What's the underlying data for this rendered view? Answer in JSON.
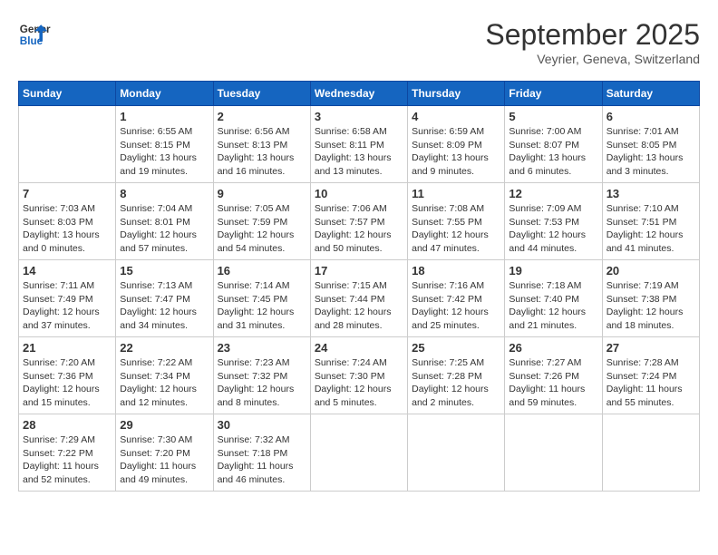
{
  "logo": {
    "line1": "General",
    "line2": "Blue"
  },
  "title": "September 2025",
  "location": "Veyrier, Geneva, Switzerland",
  "weekdays": [
    "Sunday",
    "Monday",
    "Tuesday",
    "Wednesday",
    "Thursday",
    "Friday",
    "Saturday"
  ],
  "weeks": [
    [
      {
        "day": "",
        "info": ""
      },
      {
        "day": "1",
        "info": "Sunrise: 6:55 AM\nSunset: 8:15 PM\nDaylight: 13 hours\nand 19 minutes."
      },
      {
        "day": "2",
        "info": "Sunrise: 6:56 AM\nSunset: 8:13 PM\nDaylight: 13 hours\nand 16 minutes."
      },
      {
        "day": "3",
        "info": "Sunrise: 6:58 AM\nSunset: 8:11 PM\nDaylight: 13 hours\nand 13 minutes."
      },
      {
        "day": "4",
        "info": "Sunrise: 6:59 AM\nSunset: 8:09 PM\nDaylight: 13 hours\nand 9 minutes."
      },
      {
        "day": "5",
        "info": "Sunrise: 7:00 AM\nSunset: 8:07 PM\nDaylight: 13 hours\nand 6 minutes."
      },
      {
        "day": "6",
        "info": "Sunrise: 7:01 AM\nSunset: 8:05 PM\nDaylight: 13 hours\nand 3 minutes."
      }
    ],
    [
      {
        "day": "7",
        "info": "Sunrise: 7:03 AM\nSunset: 8:03 PM\nDaylight: 13 hours\nand 0 minutes."
      },
      {
        "day": "8",
        "info": "Sunrise: 7:04 AM\nSunset: 8:01 PM\nDaylight: 12 hours\nand 57 minutes."
      },
      {
        "day": "9",
        "info": "Sunrise: 7:05 AM\nSunset: 7:59 PM\nDaylight: 12 hours\nand 54 minutes."
      },
      {
        "day": "10",
        "info": "Sunrise: 7:06 AM\nSunset: 7:57 PM\nDaylight: 12 hours\nand 50 minutes."
      },
      {
        "day": "11",
        "info": "Sunrise: 7:08 AM\nSunset: 7:55 PM\nDaylight: 12 hours\nand 47 minutes."
      },
      {
        "day": "12",
        "info": "Sunrise: 7:09 AM\nSunset: 7:53 PM\nDaylight: 12 hours\nand 44 minutes."
      },
      {
        "day": "13",
        "info": "Sunrise: 7:10 AM\nSunset: 7:51 PM\nDaylight: 12 hours\nand 41 minutes."
      }
    ],
    [
      {
        "day": "14",
        "info": "Sunrise: 7:11 AM\nSunset: 7:49 PM\nDaylight: 12 hours\nand 37 minutes."
      },
      {
        "day": "15",
        "info": "Sunrise: 7:13 AM\nSunset: 7:47 PM\nDaylight: 12 hours\nand 34 minutes."
      },
      {
        "day": "16",
        "info": "Sunrise: 7:14 AM\nSunset: 7:45 PM\nDaylight: 12 hours\nand 31 minutes."
      },
      {
        "day": "17",
        "info": "Sunrise: 7:15 AM\nSunset: 7:44 PM\nDaylight: 12 hours\nand 28 minutes."
      },
      {
        "day": "18",
        "info": "Sunrise: 7:16 AM\nSunset: 7:42 PM\nDaylight: 12 hours\nand 25 minutes."
      },
      {
        "day": "19",
        "info": "Sunrise: 7:18 AM\nSunset: 7:40 PM\nDaylight: 12 hours\nand 21 minutes."
      },
      {
        "day": "20",
        "info": "Sunrise: 7:19 AM\nSunset: 7:38 PM\nDaylight: 12 hours\nand 18 minutes."
      }
    ],
    [
      {
        "day": "21",
        "info": "Sunrise: 7:20 AM\nSunset: 7:36 PM\nDaylight: 12 hours\nand 15 minutes."
      },
      {
        "day": "22",
        "info": "Sunrise: 7:22 AM\nSunset: 7:34 PM\nDaylight: 12 hours\nand 12 minutes."
      },
      {
        "day": "23",
        "info": "Sunrise: 7:23 AM\nSunset: 7:32 PM\nDaylight: 12 hours\nand 8 minutes."
      },
      {
        "day": "24",
        "info": "Sunrise: 7:24 AM\nSunset: 7:30 PM\nDaylight: 12 hours\nand 5 minutes."
      },
      {
        "day": "25",
        "info": "Sunrise: 7:25 AM\nSunset: 7:28 PM\nDaylight: 12 hours\nand 2 minutes."
      },
      {
        "day": "26",
        "info": "Sunrise: 7:27 AM\nSunset: 7:26 PM\nDaylight: 11 hours\nand 59 minutes."
      },
      {
        "day": "27",
        "info": "Sunrise: 7:28 AM\nSunset: 7:24 PM\nDaylight: 11 hours\nand 55 minutes."
      }
    ],
    [
      {
        "day": "28",
        "info": "Sunrise: 7:29 AM\nSunset: 7:22 PM\nDaylight: 11 hours\nand 52 minutes."
      },
      {
        "day": "29",
        "info": "Sunrise: 7:30 AM\nSunset: 7:20 PM\nDaylight: 11 hours\nand 49 minutes."
      },
      {
        "day": "30",
        "info": "Sunrise: 7:32 AM\nSunset: 7:18 PM\nDaylight: 11 hours\nand 46 minutes."
      },
      {
        "day": "",
        "info": ""
      },
      {
        "day": "",
        "info": ""
      },
      {
        "day": "",
        "info": ""
      },
      {
        "day": "",
        "info": ""
      }
    ]
  ]
}
